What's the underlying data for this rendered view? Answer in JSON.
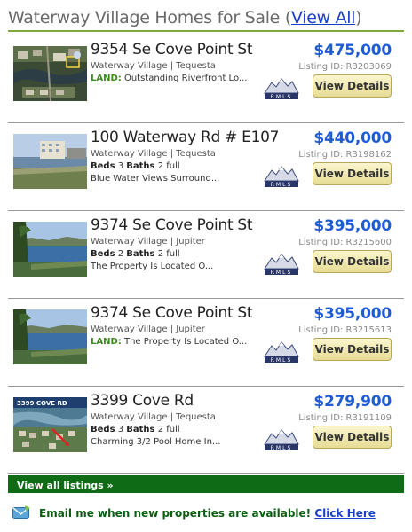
{
  "header": {
    "title": "Waterway Village Homes for Sale",
    "paren_open": " (",
    "view_all_label": "View All",
    "paren_close": ")"
  },
  "listings": [
    {
      "address": "9354 Se Cove Point St",
      "location": "Waterway Village | Tequesta",
      "price": "$475,000",
      "listing_id": "Listing ID: R3203069",
      "type": "land",
      "land_label": "LAND:",
      "description": "Outstanding Riverfront Lo...",
      "button": "View Details",
      "logo_text": "RMLS",
      "photo": "aerial-lot-photo"
    },
    {
      "address": "100 Waterway Rd # E107",
      "location": "Waterway Village | Tequesta",
      "price": "$440,000",
      "listing_id": "Listing ID: R3198162",
      "type": "home",
      "beds_label": "Beds",
      "beds": "3",
      "baths_label": "Baths",
      "baths": "2 full",
      "description": "Blue Water Views Surround...",
      "button": "View Details",
      "logo_text": "RMLS",
      "photo": "waterfront-condo-photo"
    },
    {
      "address": "9374 Se Cove Point St",
      "location": "Waterway Village | Jupiter",
      "price": "$395,000",
      "listing_id": "Listing ID: R3215600",
      "type": "home",
      "beds_label": "Beds",
      "beds": "2",
      "baths_label": "Baths",
      "baths": "2 full",
      "description": "The Property Is Located O...",
      "button": "View Details",
      "logo_text": "RMLS",
      "photo": "lake-view-photo"
    },
    {
      "address": "9374 Se Cove Point St",
      "location": "Waterway Village | Jupiter",
      "price": "$395,000",
      "listing_id": "Listing ID: R3215613",
      "type": "land",
      "land_label": "LAND:",
      "description": "The Property Is Located O...",
      "button": "View Details",
      "logo_text": "RMLS",
      "photo": "lake-view-photo"
    },
    {
      "address": "3399 Cove Rd",
      "location": "Waterway Village | Tequesta",
      "price": "$279,900",
      "listing_id": "Listing ID: R3191109",
      "type": "home",
      "beds_label": "Beds",
      "beds": "3",
      "baths_label": "Baths",
      "baths": "2 full",
      "description": "Charming 3/2 Pool Home In...",
      "button": "View Details",
      "logo_text": "RMLS",
      "photo": "aerial-map-photo",
      "photo_caption": "3399 COVE RD"
    }
  ],
  "footer": {
    "view_all_listings": "View all listings »",
    "email_text": "Email me when new properties are available!",
    "click_here": "Click Here"
  },
  "colors": {
    "accent_green": "#0f6b16",
    "price_blue": "#1e5bd6",
    "link_blue": "#1a3fc9",
    "land_green": "#3b8a1e"
  }
}
